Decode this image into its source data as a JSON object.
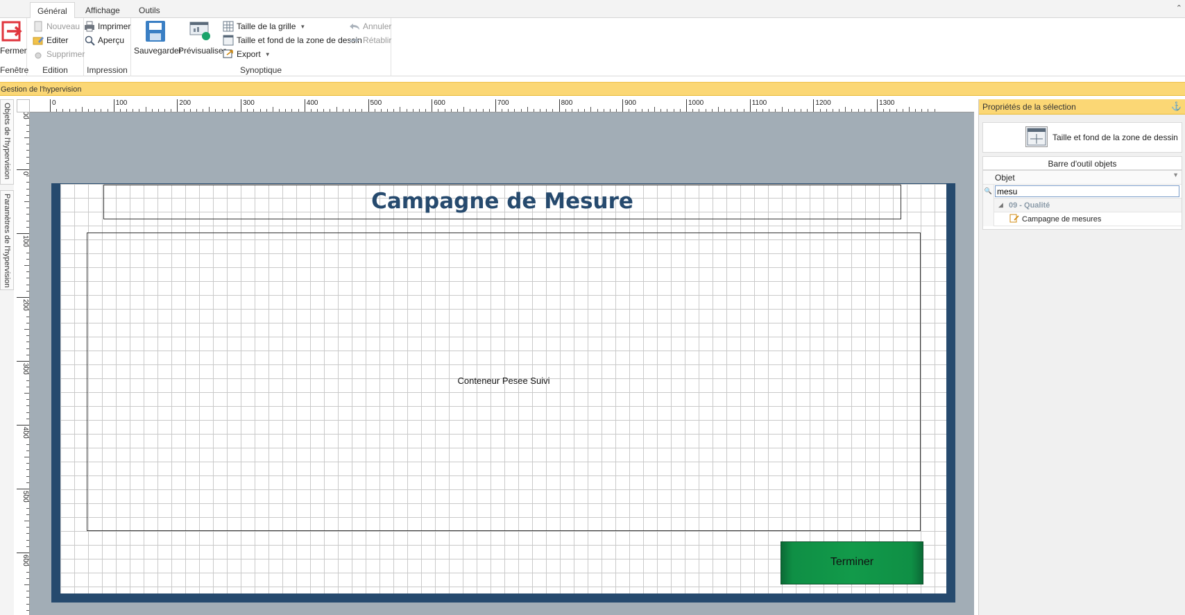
{
  "ribbon": {
    "tabs": [
      "Général",
      "Affichage",
      "Outils"
    ],
    "fenetre": {
      "close_label": "Fermer",
      "group_label": "Fenêtre"
    },
    "edition": {
      "new_label": "Nouveau",
      "edit_label": "Editer",
      "delete_label": "Supprimer",
      "group_label": "Edition"
    },
    "impression": {
      "print_label": "Imprimer",
      "preview_label": "Aperçu",
      "group_label": "Impression"
    },
    "synoptique": {
      "save_label": "Sauvegarder",
      "visualize_label": "Prévisualiser",
      "grid_size_label": "Taille de la grille",
      "drawing_area_label": "Taille et fond de la zone de dessin",
      "export_label": "Export",
      "undo_label": "Annuler",
      "redo_label": "Rétablir",
      "group_label": "Synoptique"
    }
  },
  "management_bar": "Gestion de l'hypervision",
  "side_tabs": [
    "Objets de l'hypervision",
    "Paramètres de l'hypervision"
  ],
  "ruler": {
    "h_labels": [
      "0",
      "100",
      "200",
      "300",
      "400",
      "500",
      "600",
      "700",
      "800",
      "900",
      "1000",
      "1100",
      "1200",
      "1300"
    ],
    "v_labels": [
      "100",
      "0",
      "100",
      "200",
      "300",
      "400",
      "500",
      "600"
    ]
  },
  "canvas": {
    "title": "Campagne de Mesure",
    "container_label": "Conteneur Pesee Suivi",
    "finish_button": "Terminer"
  },
  "panel": {
    "title": "Propriétés de la sélection",
    "drawing_area_button": "Taille et fond de la zone de dessin",
    "toolbar_label": "Barre d'outil objets",
    "column_header": "Objet",
    "filter_value": "mesu",
    "group_row": "09 - Qualité",
    "item_row": "Campagne de mesures"
  },
  "colors": {
    "accent_yellow": "#fbd775",
    "board_blue": "#264a6e",
    "finish_green": "#129a4a",
    "close_red": "#e0353d"
  }
}
